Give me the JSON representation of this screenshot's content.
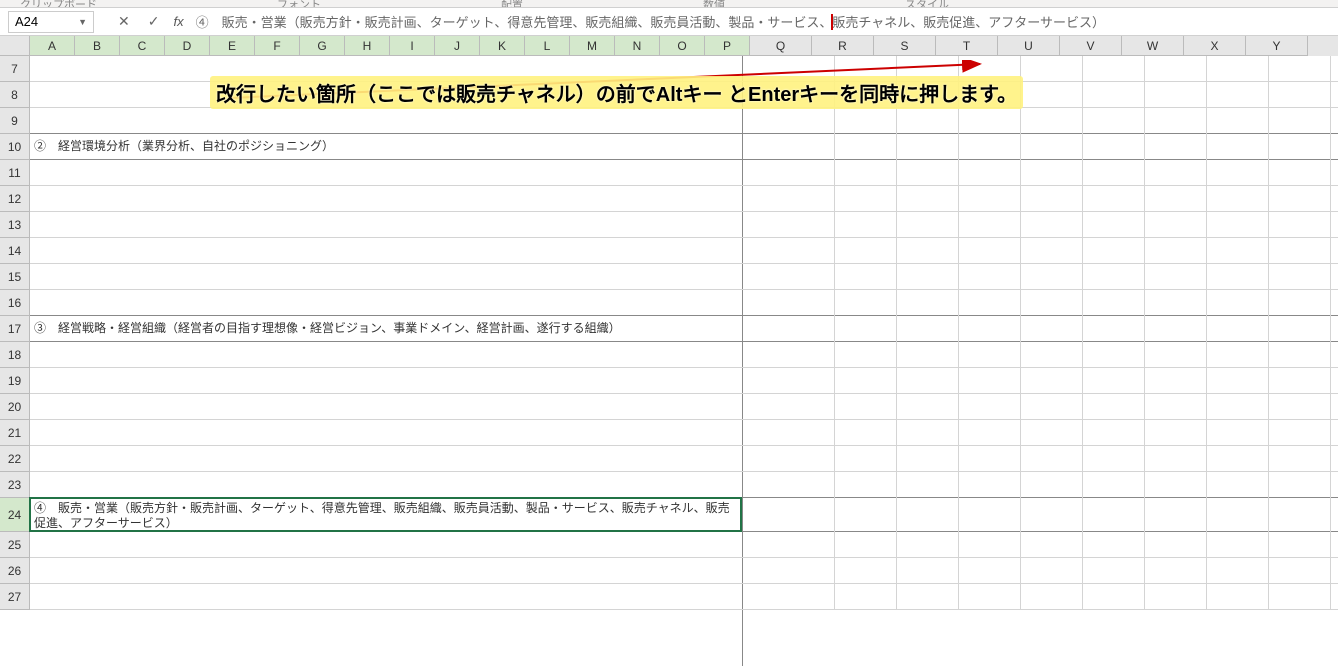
{
  "ribbon": {
    "tabs": [
      "クリップボード",
      "フォント",
      "配置",
      "数値",
      "スタイル"
    ]
  },
  "nameBox": {
    "value": "A24"
  },
  "formula": {
    "cancel": "✕",
    "confirm": "✓",
    "fx": "fx",
    "part1": "④　販売・営業（販売方針・販売計画、ターゲット、得意先管理、販売組織、販売員活動、製品・サービス、",
    "part2": "販売チャネル、販売促進、アフターサービス）"
  },
  "columns": [
    "A",
    "B",
    "C",
    "D",
    "E",
    "F",
    "G",
    "H",
    "I",
    "J",
    "K",
    "L",
    "M",
    "N",
    "O",
    "P",
    "Q",
    "R",
    "S",
    "T",
    "U",
    "V",
    "W",
    "X",
    "Y"
  ],
  "rows": [
    "7",
    "8",
    "9",
    "10",
    "11",
    "12",
    "13",
    "14",
    "15",
    "16",
    "17",
    "18",
    "19",
    "20",
    "21",
    "22",
    "23",
    "24",
    "25",
    "26",
    "27"
  ],
  "cells": {
    "row10": "②　経営環境分析（業界分析、自社のポジショニング）",
    "row17": "③　経営戦略・経営組織（経営者の目指す理想像・経営ビジョン、事業ドメイン、経営計画、遂行する組織）",
    "row24": "④　販売・営業（販売方針・販売計画、ターゲット、得意先管理、販売組織、販売員活動、製品・サービス、販売チャネル、販売促進、アフターサービス）"
  },
  "annotation": "改行したい箇所（ここでは販売チャネル）の前でAltキー とEnterキーを同時に押します。",
  "selectedColumns": [
    "A",
    "B",
    "C",
    "D",
    "E",
    "F",
    "G",
    "H",
    "I",
    "J",
    "K",
    "L",
    "M",
    "N",
    "O",
    "P"
  ],
  "selectedRow": "24"
}
